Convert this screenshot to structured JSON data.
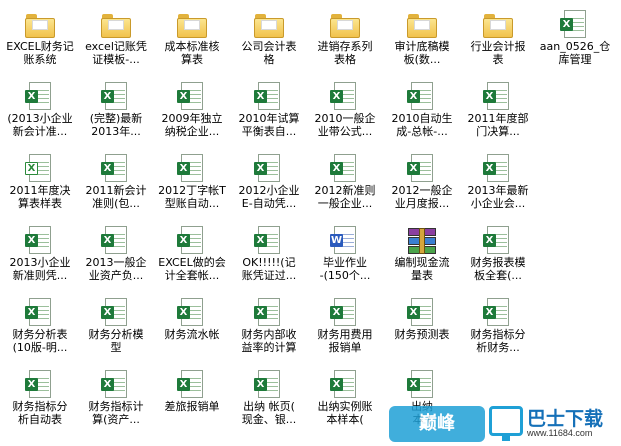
{
  "items": [
    {
      "icon": "folder",
      "label": "EXCEL财务记\n账系统"
    },
    {
      "icon": "folder",
      "label": "excel记账凭\n证模板-..."
    },
    {
      "icon": "folder",
      "label": "成本标准核\n算表"
    },
    {
      "icon": "folder",
      "label": "公司会计表\n格"
    },
    {
      "icon": "folder",
      "label": "进销存系列\n表格"
    },
    {
      "icon": "folder",
      "label": "审计底稿模\n板(数..."
    },
    {
      "icon": "folder",
      "label": "行业会计报\n表"
    },
    {
      "icon": "excel",
      "label": "aan_0526_仓\n库管理"
    },
    {
      "icon": "excel",
      "label": "(2013小企业\n新会计准..."
    },
    {
      "icon": "excel",
      "label": "(完整)最新\n2013年..."
    },
    {
      "icon": "excel",
      "label": "2009年独立\n纳税企业..."
    },
    {
      "icon": "excel",
      "label": "2010年试算\n平衡表自..."
    },
    {
      "icon": "excel",
      "label": "2010一般企\n业带公式..."
    },
    {
      "icon": "excel",
      "label": "2010自动生\n成-总帐-..."
    },
    {
      "icon": "excel",
      "label": "2011年度部\n门决算..."
    },
    {
      "icon": "none",
      "label": ""
    },
    {
      "icon": "excel-old",
      "label": "2011年度决\n算表样表"
    },
    {
      "icon": "excel",
      "label": "2011新会计\n准则(包..."
    },
    {
      "icon": "excel",
      "label": "2012丁字帐T\n型账自动..."
    },
    {
      "icon": "excel",
      "label": "2012小企业\nE-自动凭..."
    },
    {
      "icon": "excel",
      "label": "2012新准则\n一般企业..."
    },
    {
      "icon": "excel",
      "label": "2012一般企\n业月度报..."
    },
    {
      "icon": "excel",
      "label": "2013年最新\n小企业会..."
    },
    {
      "icon": "none",
      "label": ""
    },
    {
      "icon": "excel",
      "label": "2013小企业\n新准则凭..."
    },
    {
      "icon": "excel",
      "label": "2013一般企\n业资产负..."
    },
    {
      "icon": "excel",
      "label": "EXCEL做的会\n计全套帐..."
    },
    {
      "icon": "excel",
      "label": "OK!!!!!(记\n账凭证过..."
    },
    {
      "icon": "word",
      "label": "毕业作业\n-(150个..."
    },
    {
      "icon": "rar",
      "label": "编制现金流\n量表"
    },
    {
      "icon": "excel",
      "label": "财务报表模\n板全套(..."
    },
    {
      "icon": "none",
      "label": ""
    },
    {
      "icon": "excel",
      "label": "财务分析表\n(10版-明..."
    },
    {
      "icon": "excel",
      "label": "财务分析模\n型"
    },
    {
      "icon": "excel",
      "label": "财务流水帐"
    },
    {
      "icon": "excel",
      "label": "财务内部收\n益率的计算"
    },
    {
      "icon": "excel",
      "label": "财务用费用\n报销单"
    },
    {
      "icon": "excel",
      "label": "财务预测表"
    },
    {
      "icon": "excel",
      "label": "财务指标分\n析财务..."
    },
    {
      "icon": "none",
      "label": ""
    },
    {
      "icon": "excel",
      "label": "财务指标分\n析自动表"
    },
    {
      "icon": "excel",
      "label": "财务指标计\n算(资产..."
    },
    {
      "icon": "excel",
      "label": "差旅报销单"
    },
    {
      "icon": "excel",
      "label": "出纳 帐页(\n现金、银..."
    },
    {
      "icon": "excel",
      "label": "出纳实例账\n本样本("
    },
    {
      "icon": "excel",
      "label": "出纳\n本 ("
    },
    {
      "icon": "none",
      "label": ""
    },
    {
      "icon": "none",
      "label": ""
    }
  ],
  "watermark": {
    "logo_text": "巅峰",
    "title": "巴士下载",
    "url": "www.11684.com"
  }
}
